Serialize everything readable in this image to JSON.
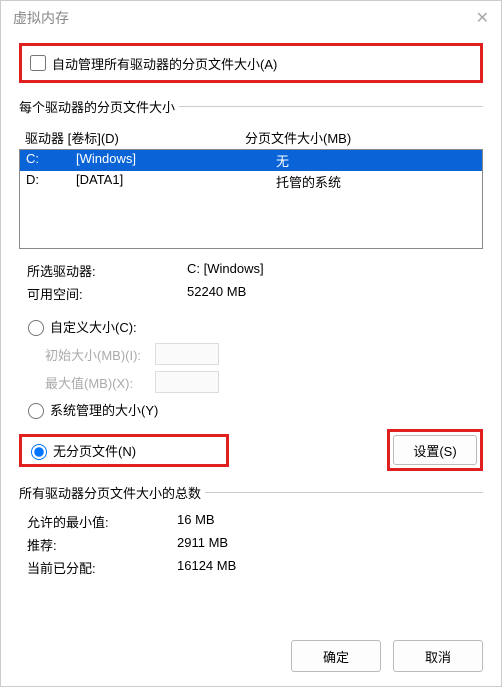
{
  "window": {
    "title": "虚拟内存"
  },
  "autoManage": {
    "label": "自动管理所有驱动器的分页文件大小(A)",
    "checked": false
  },
  "drives": {
    "groupLabel": "每个驱动器的分页文件大小",
    "headerDrive": "驱动器 [卷标](D)",
    "headerSize": "分页文件大小(MB)",
    "rows": [
      {
        "letter": "C:",
        "label": "[Windows]",
        "size": "无",
        "selected": true
      },
      {
        "letter": "D:",
        "label": "[DATA1]",
        "size": "托管的系统",
        "selected": false
      }
    ]
  },
  "selected": {
    "driveLabel": "所选驱动器:",
    "driveValue": "C:  [Windows]",
    "spaceLabel": "可用空间:",
    "spaceValue": "52240 MB"
  },
  "options": {
    "custom": "自定义大小(C):",
    "initial": "初始大小(MB)(I):",
    "max": "最大值(MB)(X):",
    "system": "系统管理的大小(Y)",
    "none": "无分页文件(N)",
    "selected": "none",
    "setButton": "设置(S)"
  },
  "totals": {
    "groupLabel": "所有驱动器分页文件大小的总数",
    "minLabel": "允许的最小值:",
    "minValue": "16 MB",
    "recLabel": "推荐:",
    "recValue": "2911 MB",
    "curLabel": "当前已分配:",
    "curValue": "16124 MB"
  },
  "buttons": {
    "ok": "确定",
    "cancel": "取消"
  }
}
